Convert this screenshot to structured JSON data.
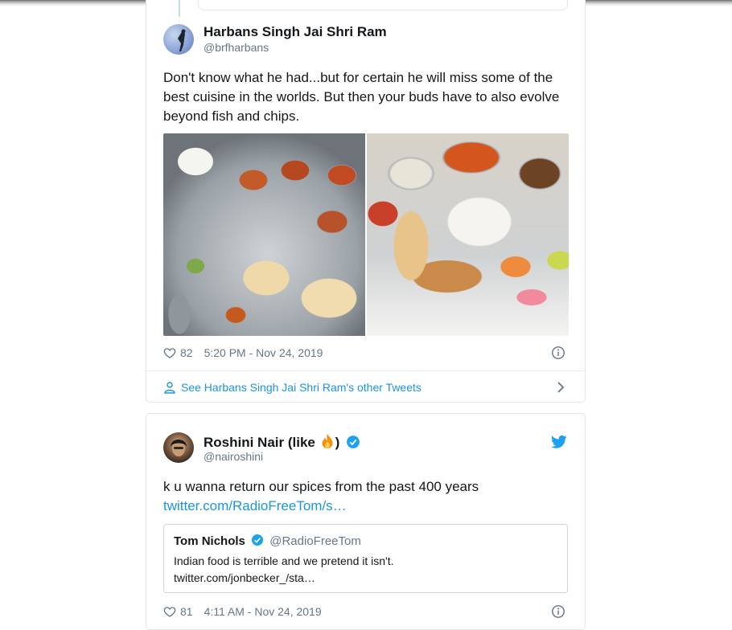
{
  "tweet1": {
    "author_name": "Harbans Singh Jai Shri Ram",
    "author_handle": "@brfharbans",
    "text": "Don't know what he had...but for certain he will miss some of the best cuisine in the worlds. But then your buds have to also evolve beyond fish and chips.",
    "media_alt": [
      "thali-platter-photo",
      "indian-meal-photo"
    ],
    "likes": "82",
    "timestamp": "5:20 PM - Nov 24, 2019",
    "see_more": "See Harbans Singh Jai Shri Ram's other Tweets"
  },
  "tweet2": {
    "author_name_before": "Roshini Nair (like ",
    "author_name_after": ")",
    "author_handle": "@nairoshini",
    "text": "k u wanna return our spices from the past 400 years",
    "link": "twitter.com/RadioFreeTom/s…",
    "quote": {
      "author_name": "Tom Nichols",
      "author_handle": "@RadioFreeTom",
      "text_line1": "Indian food is terrible and we pretend it isn't.",
      "text_line2": "twitter.com/jonbecker_/sta…"
    },
    "likes": "81",
    "timestamp": "4:11 AM - Nov 24, 2019"
  },
  "icons": [
    "heart-icon",
    "info-icon",
    "person-icon",
    "chevron-right-icon",
    "twitter-bird-icon",
    "verified-badge-icon",
    "fire-emoji-icon"
  ],
  "colors": {
    "link": "#1b95e0",
    "text": "#14171a",
    "secondary": "#657786",
    "border": "#e1e8ed",
    "verified": "#1da1f2"
  }
}
